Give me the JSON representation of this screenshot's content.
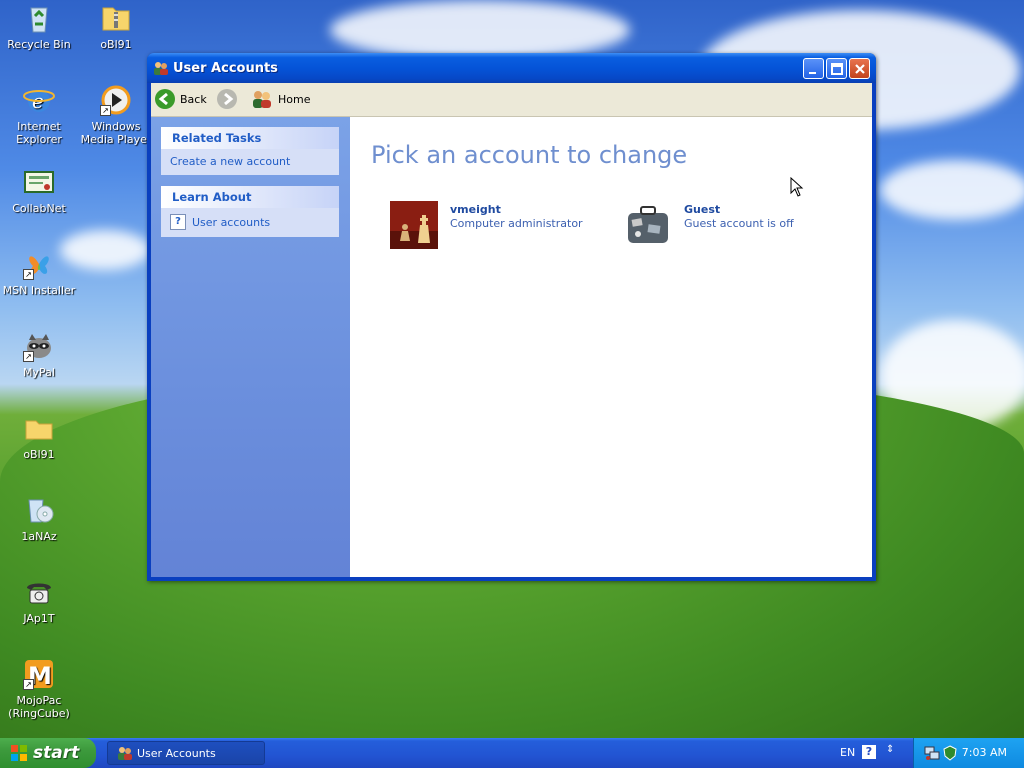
{
  "desktop": {
    "icons": [
      {
        "label": "Recycle Bin",
        "icon": "recycle-bin-icon"
      },
      {
        "label": "oBl91",
        "icon": "zip-folder-icon"
      },
      {
        "label": "Internet Explorer",
        "icon": "internet-explorer-icon"
      },
      {
        "label": "Windows Media Player",
        "icon": "media-player-icon"
      },
      {
        "label": "CollabNet",
        "icon": "certificate-icon"
      },
      {
        "label": "MSN Installer",
        "icon": "msn-butterfly-icon"
      },
      {
        "label": "MyPal",
        "icon": "raccoon-icon"
      },
      {
        "label": "oBl91",
        "icon": "folder-icon"
      },
      {
        "label": "1aNAz",
        "icon": "recycle-cd-icon"
      },
      {
        "label": "JAp1T",
        "icon": "telephone-icon"
      },
      {
        "label": "MojoPac (RingCube)",
        "icon": "mojopac-icon"
      }
    ]
  },
  "window": {
    "title": "User Accounts",
    "toolbar": {
      "back_label": "Back",
      "home_label": "Home"
    },
    "related_tasks": {
      "header": "Related Tasks",
      "links": [
        "Create a new account"
      ]
    },
    "learn_about": {
      "header": "Learn About",
      "links": [
        "User accounts"
      ]
    },
    "main": {
      "heading": "Pick an account to change",
      "accounts": [
        {
          "name": "vmeight",
          "role": "Computer administrator",
          "picture": "chess-pieces-icon"
        },
        {
          "name": "Guest",
          "role": "Guest account is off",
          "picture": "suitcase-icon"
        }
      ]
    }
  },
  "taskbar": {
    "start_label": "start",
    "tasks": [
      {
        "label": "User Accounts"
      }
    ],
    "language": "EN",
    "clock": "7:03 AM"
  },
  "colors": {
    "xp_blue": "#0554d8",
    "start_green": "#3d9a3d",
    "link_blue": "#215dc6",
    "heading_blue": "#6f8fcf"
  }
}
